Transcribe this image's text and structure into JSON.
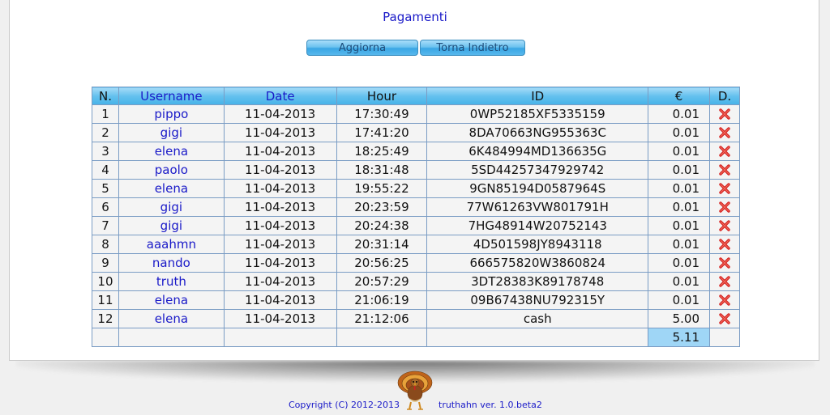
{
  "page": {
    "title": "Pagamenti"
  },
  "toolbar": {
    "refresh_label": "Aggiorna",
    "back_label": "Torna Indietro"
  },
  "table": {
    "headers": {
      "n": "N.",
      "username": "Username",
      "date": "Date",
      "hour": "Hour",
      "id": "ID",
      "amount": "€",
      "delete": "D."
    },
    "rows": [
      {
        "n": "1",
        "username": "pippo",
        "date": "11-04-2013",
        "hour": "17:30:49",
        "id": "0WP52185XF5335159",
        "amount": "0.01"
      },
      {
        "n": "2",
        "username": "gigi",
        "date": "11-04-2013",
        "hour": "17:41:20",
        "id": "8DA70663NG955363C",
        "amount": "0.01"
      },
      {
        "n": "3",
        "username": "elena",
        "date": "11-04-2013",
        "hour": "18:25:49",
        "id": "6K484994MD136635G",
        "amount": "0.01"
      },
      {
        "n": "4",
        "username": "paolo",
        "date": "11-04-2013",
        "hour": "18:31:48",
        "id": "5SD44257347929742",
        "amount": "0.01"
      },
      {
        "n": "5",
        "username": "elena",
        "date": "11-04-2013",
        "hour": "19:55:22",
        "id": "9GN85194D0587964S",
        "amount": "0.01"
      },
      {
        "n": "6",
        "username": "gigi",
        "date": "11-04-2013",
        "hour": "20:23:59",
        "id": "77W61263VW801791H",
        "amount": "0.01"
      },
      {
        "n": "7",
        "username": "gigi",
        "date": "11-04-2013",
        "hour": "20:24:38",
        "id": "7HG48914W20752143",
        "amount": "0.01"
      },
      {
        "n": "8",
        "username": "aaahmn",
        "date": "11-04-2013",
        "hour": "20:31:14",
        "id": "4D501598JY8943118",
        "amount": "0.01"
      },
      {
        "n": "9",
        "username": "nando",
        "date": "11-04-2013",
        "hour": "20:56:25",
        "id": "666575820W3860824",
        "amount": "0.01"
      },
      {
        "n": "10",
        "username": "truth",
        "date": "11-04-2013",
        "hour": "20:57:29",
        "id": "3DT28383K89178748",
        "amount": "0.01"
      },
      {
        "n": "11",
        "username": "elena",
        "date": "11-04-2013",
        "hour": "21:06:19",
        "id": "09B67438NU792315Y",
        "amount": "0.01"
      },
      {
        "n": "12",
        "username": "elena",
        "date": "11-04-2013",
        "hour": "21:12:06",
        "id": "cash",
        "amount": "5.00"
      }
    ],
    "total": "5.11",
    "delete_icon": "delete-x-icon"
  },
  "footer": {
    "copyright": "Copyright (C) 2012-2013",
    "version": "truthahn ver. 1.0.beta2",
    "logo_icon": "turkey-logo-icon"
  },
  "colors": {
    "link_blue": "#1a1ac8",
    "header_blue": "#64c1ee",
    "total_cell": "#9fd6f6",
    "delete_red": "#d42020"
  }
}
